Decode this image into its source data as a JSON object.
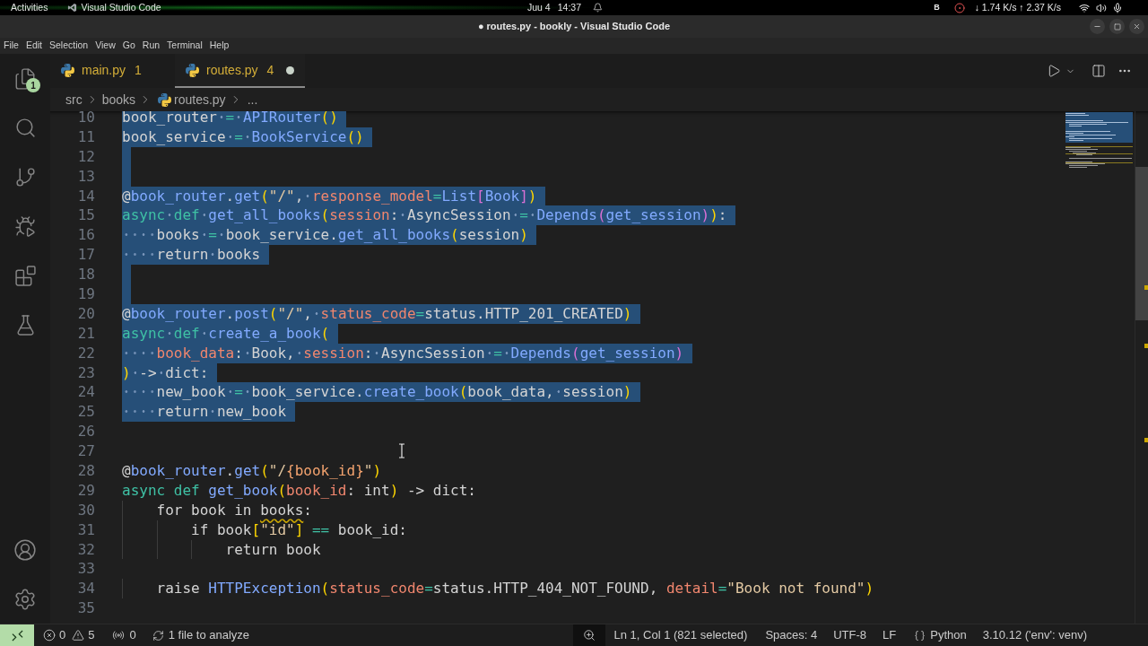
{
  "system_bar": {
    "activities": "Activities",
    "app": "Visual Studio Code",
    "date": "Juu 4",
    "time": "14:37",
    "indicator": "B",
    "network": "↓ 1.74 K/s ↑ 2.37 K/s"
  },
  "window": {
    "title": "● routes.py - bookly - Visual Studio Code"
  },
  "menu": [
    "File",
    "Edit",
    "Selection",
    "View",
    "Go",
    "Run",
    "Terminal",
    "Help"
  ],
  "activity_bar": {
    "explorer_badge": "1"
  },
  "tabs": [
    {
      "name": "main.py",
      "problems": "1",
      "selected": false,
      "modified": false
    },
    {
      "name": "routes.py",
      "problems": "4",
      "selected": true,
      "modified": true
    }
  ],
  "breadcrumbs": [
    {
      "label": "src",
      "kind": "folder"
    },
    {
      "label": "books",
      "kind": "folder"
    },
    {
      "label": "routes.py",
      "kind": "file"
    },
    {
      "label": "...",
      "kind": "symbol"
    }
  ],
  "editor": {
    "lines": [
      {
        "number": "10",
        "selected": true,
        "tokens": [
          {
            "text": "book_router",
            "kind": "plain"
          },
          {
            "text": " = ",
            "kind": "operator"
          },
          {
            "text": "APIRouter",
            "kind": "function"
          },
          {
            "text": "()",
            "kind": "bracket1"
          }
        ]
      },
      {
        "number": "11",
        "selected": true,
        "tokens": [
          {
            "text": "book_service",
            "kind": "plain"
          },
          {
            "text": " = ",
            "kind": "operator"
          },
          {
            "text": "BookService",
            "kind": "function"
          },
          {
            "text": "()",
            "kind": "bracket1"
          }
        ]
      },
      {
        "number": "12",
        "selected": true
      },
      {
        "number": "13",
        "selected": true
      },
      {
        "number": "14",
        "selected": true,
        "tokens": [
          {
            "text": "@",
            "kind": "plain"
          },
          {
            "text": "book_router",
            "kind": "function"
          },
          {
            "text": ".",
            "kind": "plain"
          },
          {
            "text": "get",
            "kind": "function"
          },
          {
            "text": "(",
            "kind": "bracket1"
          },
          {
            "text": "\"/\"",
            "kind": "string"
          },
          {
            "text": ", ",
            "kind": "plain"
          },
          {
            "text": "response_model",
            "kind": "param"
          },
          {
            "text": "=",
            "kind": "operator"
          },
          {
            "text": "List",
            "kind": "function"
          },
          {
            "text": "[",
            "kind": "bracket2"
          },
          {
            "text": "Book",
            "kind": "function"
          },
          {
            "text": "]",
            "kind": "bracket2"
          },
          {
            "text": ")",
            "kind": "bracket1"
          }
        ]
      },
      {
        "number": "15",
        "selected": true,
        "tokens": [
          {
            "text": "async def ",
            "kind": "keyword"
          },
          {
            "text": "get_all_books",
            "kind": "function"
          },
          {
            "text": "(",
            "kind": "bracket1"
          },
          {
            "text": "session",
            "kind": "param"
          },
          {
            "text": ": AsyncSession",
            "kind": "plain"
          },
          {
            "text": " = ",
            "kind": "operator"
          },
          {
            "text": "Depends",
            "kind": "function"
          },
          {
            "text": "(",
            "kind": "bracket2"
          },
          {
            "text": "get_session",
            "kind": "function"
          },
          {
            "text": ")",
            "kind": "bracket2"
          },
          {
            "text": ")",
            "kind": "bracket1"
          },
          {
            "text": ":",
            "kind": "plain"
          }
        ]
      },
      {
        "number": "16",
        "selected": true,
        "tokens": [
          {
            "text": "    books",
            "kind": "plain"
          },
          {
            "text": " = ",
            "kind": "operator"
          },
          {
            "text": "book_service.",
            "kind": "plain"
          },
          {
            "text": "get_all_books",
            "kind": "function"
          },
          {
            "text": "(",
            "kind": "bracket1"
          },
          {
            "text": "session",
            "kind": "plain"
          },
          {
            "text": ")",
            "kind": "bracket1"
          }
        ]
      },
      {
        "number": "17",
        "selected": true,
        "tokens": [
          {
            "text": "    return books",
            "kind": "plain"
          }
        ]
      },
      {
        "number": "18",
        "selected": true
      },
      {
        "number": "19",
        "selected": true
      },
      {
        "number": "20",
        "selected": true,
        "tokens": [
          {
            "text": "@",
            "kind": "plain"
          },
          {
            "text": "book_router",
            "kind": "function"
          },
          {
            "text": ".",
            "kind": "plain"
          },
          {
            "text": "post",
            "kind": "function"
          },
          {
            "text": "(",
            "kind": "bracket1"
          },
          {
            "text": "\"/\"",
            "kind": "string"
          },
          {
            "text": ", ",
            "kind": "plain"
          },
          {
            "text": "status_code",
            "kind": "param"
          },
          {
            "text": "=",
            "kind": "operator"
          },
          {
            "text": "status.HTTP_201_CREATED",
            "kind": "plain"
          },
          {
            "text": ")",
            "kind": "bracket1"
          }
        ]
      },
      {
        "number": "21",
        "selected": true,
        "tokens": [
          {
            "text": "async def ",
            "kind": "keyword"
          },
          {
            "text": "create_a_book",
            "kind": "function"
          },
          {
            "text": "(",
            "kind": "bracket1"
          }
        ]
      },
      {
        "number": "22",
        "selected": true,
        "tokens": [
          {
            "text": "    book_data",
            "kind": "param"
          },
          {
            "text": ": Book, ",
            "kind": "plain"
          },
          {
            "text": "session",
            "kind": "param"
          },
          {
            "text": ": AsyncSession",
            "kind": "plain"
          },
          {
            "text": " = ",
            "kind": "operator"
          },
          {
            "text": "Depends",
            "kind": "function"
          },
          {
            "text": "(",
            "kind": "bracket2"
          },
          {
            "text": "get_session",
            "kind": "function"
          },
          {
            "text": ")",
            "kind": "bracket2"
          }
        ]
      },
      {
        "number": "23",
        "selected": true,
        "tokens": [
          {
            "text": ")",
            "kind": "bracket1"
          },
          {
            "text": " -> dict:",
            "kind": "plain"
          }
        ]
      },
      {
        "number": "24",
        "selected": true,
        "tokens": [
          {
            "text": "    new_book",
            "kind": "plain"
          },
          {
            "text": " = ",
            "kind": "operator"
          },
          {
            "text": "book_service.",
            "kind": "plain"
          },
          {
            "text": "create_book",
            "kind": "function"
          },
          {
            "text": "(",
            "kind": "bracket1"
          },
          {
            "text": "book_data, session",
            "kind": "plain"
          },
          {
            "text": ")",
            "kind": "bracket1"
          }
        ]
      },
      {
        "number": "25",
        "selected": true,
        "tokens": [
          {
            "text": "    return new_book",
            "kind": "plain"
          }
        ]
      },
      {
        "number": "26",
        "selected": false
      },
      {
        "number": "27",
        "selected": false
      },
      {
        "number": "28",
        "selected": false,
        "tokens": [
          {
            "text": "@",
            "kind": "plain"
          },
          {
            "text": "book_router",
            "kind": "function"
          },
          {
            "text": ".",
            "kind": "plain"
          },
          {
            "text": "get",
            "kind": "function"
          },
          {
            "text": "(",
            "kind": "bracket1"
          },
          {
            "text": "\"/",
            "kind": "string"
          },
          {
            "text": "{book_id}",
            "kind": "interp"
          },
          {
            "text": "\"",
            "kind": "string"
          },
          {
            "text": ")",
            "kind": "bracket1"
          }
        ]
      },
      {
        "number": "29",
        "selected": false,
        "tokens": [
          {
            "text": "async def ",
            "kind": "keyword"
          },
          {
            "text": "get_book",
            "kind": "function"
          },
          {
            "text": "(",
            "kind": "bracket1"
          },
          {
            "text": "book_id",
            "kind": "param"
          },
          {
            "text": ": int",
            "kind": "plain"
          },
          {
            "text": ")",
            "kind": "bracket1"
          },
          {
            "text": " -> dict:",
            "kind": "plain"
          }
        ]
      },
      {
        "number": "30",
        "selected": false,
        "tokens": [
          {
            "text": "    for book in ",
            "kind": "plain"
          },
          {
            "text": "books",
            "kind": "warning"
          },
          {
            "text": ":",
            "kind": "plain"
          }
        ]
      },
      {
        "number": "31",
        "selected": false,
        "tokens": [
          {
            "text": "        if book",
            "kind": "plain"
          },
          {
            "text": "[",
            "kind": "bracket1"
          },
          {
            "text": "\"id\"",
            "kind": "string"
          },
          {
            "text": "]",
            "kind": "bracket1"
          },
          {
            "text": " == ",
            "kind": "operator"
          },
          {
            "text": "book_id:",
            "kind": "plain"
          }
        ]
      },
      {
        "number": "32",
        "selected": false,
        "tokens": [
          {
            "text": "            return book",
            "kind": "plain"
          }
        ]
      },
      {
        "number": "33",
        "selected": false
      },
      {
        "number": "34",
        "selected": false,
        "tokens": [
          {
            "text": "    raise ",
            "kind": "plain"
          },
          {
            "text": "HTTPException",
            "kind": "function"
          },
          {
            "text": "(",
            "kind": "bracket1"
          },
          {
            "text": "status_code",
            "kind": "param"
          },
          {
            "text": "=",
            "kind": "operator"
          },
          {
            "text": "status.HTTP_404_NOT_FOUND, ",
            "kind": "plain"
          },
          {
            "text": "detail",
            "kind": "param"
          },
          {
            "text": "=",
            "kind": "operator"
          },
          {
            "text": "\"Book not found\"",
            "kind": "string"
          },
          {
            "text": ")",
            "kind": "bracket1"
          }
        ]
      },
      {
        "number": "35",
        "selected": false
      }
    ]
  },
  "status_bar": {
    "errors": "0",
    "warnings": "5",
    "ports": "0",
    "analysis": "1 file to analyze",
    "cursor": "Ln 1, Col 1 (821 selected)",
    "indentation": "Spaces: 4",
    "encoding": "UTF-8",
    "line_ending": "LF",
    "language": "Python",
    "interpreter": "3.10.12 ('env': venv)"
  }
}
